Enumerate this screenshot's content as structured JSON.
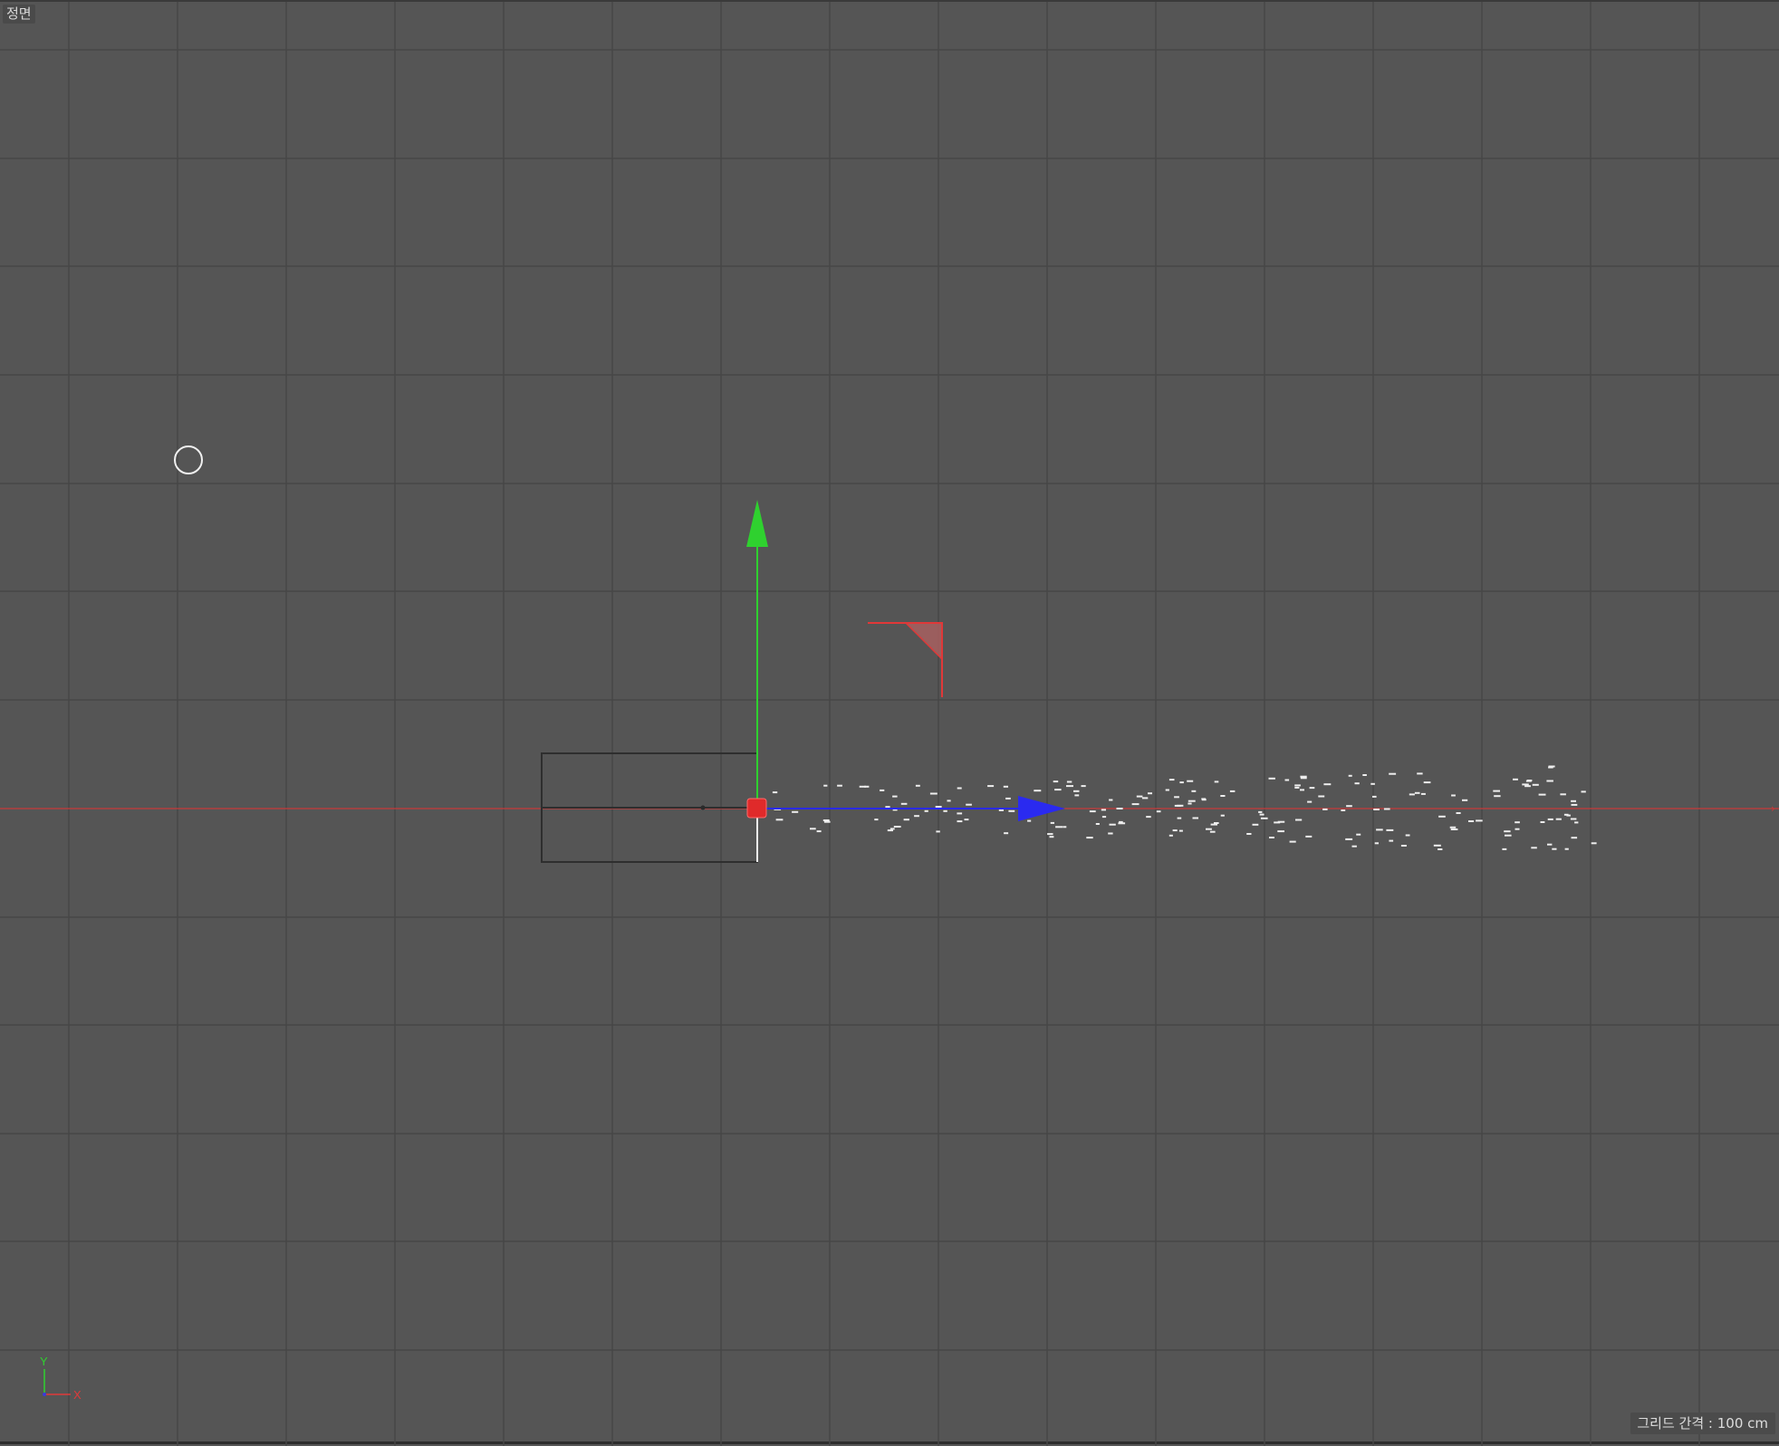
{
  "viewport": {
    "view_name": "정면",
    "grid_spacing_label": "그리드 간격 : 100 cm"
  },
  "axis_indicator": {
    "y_label": "Y",
    "x_label": "X"
  },
  "colors": {
    "background": "#555555",
    "grid_line": "#454545",
    "x_axis": "#e03a3a",
    "y_axis": "#2fd12f",
    "z_axis": "#2a2af0",
    "particles": "#eeeeee",
    "object_handle": "#e02a2a"
  },
  "icons": {
    "light": "light-circle-icon",
    "camera": "camera-frustum-icon",
    "gizmo": "move-gizmo-icon"
  }
}
